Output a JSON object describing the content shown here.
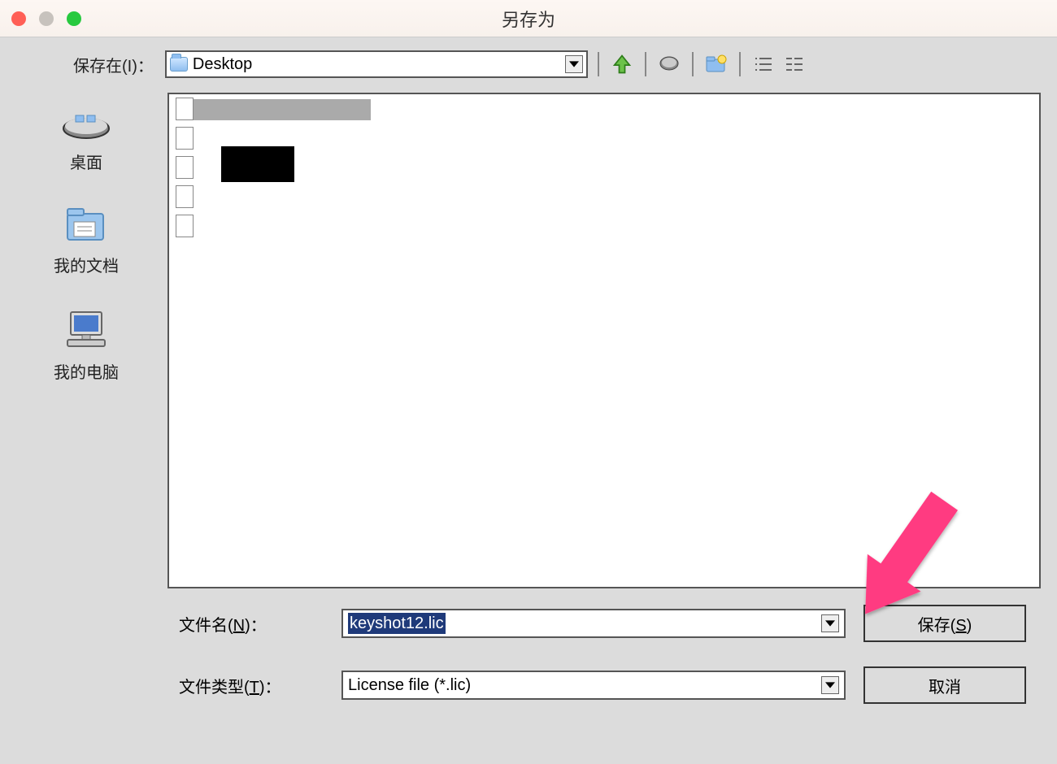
{
  "title": "另存为",
  "toolbar": {
    "lookin_label": "保存在(I)：",
    "lookin_value": "Desktop"
  },
  "sidebar": {
    "items": [
      {
        "label": "桌面"
      },
      {
        "label": "我的文档"
      },
      {
        "label": "我的电脑"
      }
    ]
  },
  "fields": {
    "filename_label": "文件名(N)：",
    "filename_value": "keyshot12.lic",
    "filetype_label": "文件类型(T)：",
    "filetype_value": "License file (*.lic)"
  },
  "buttons": {
    "save": "保存(S)",
    "cancel": "取消"
  }
}
